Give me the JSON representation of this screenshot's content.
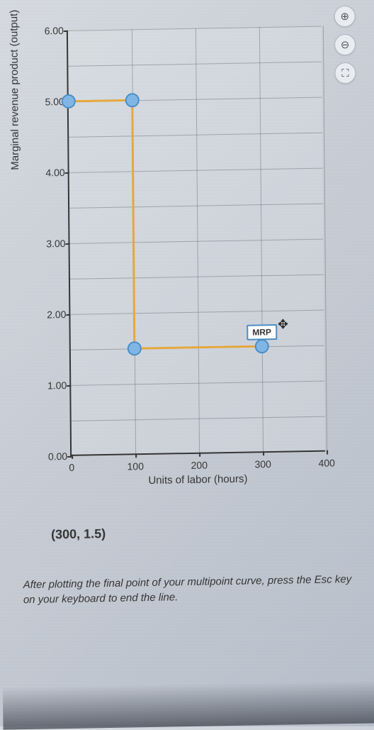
{
  "toolbar": {
    "zoom_in": "⊕",
    "zoom_out": "⊖",
    "fullscreen": "⛶"
  },
  "chart_data": {
    "type": "line",
    "title": "",
    "xlabel": "Units of labor (hours)",
    "ylabel": "Marginal revenue product (output)",
    "xlim": [
      0,
      400
    ],
    "ylim": [
      0,
      6.0
    ],
    "x_ticks": [
      0,
      100,
      200,
      300,
      400
    ],
    "y_ticks": [
      0.0,
      1.0,
      2.0,
      3.0,
      4.0,
      5.0,
      6.0
    ],
    "series": [
      {
        "name": "MRP",
        "x": [
          0,
          100,
          100,
          300
        ],
        "y": [
          5.0,
          5.0,
          1.5,
          1.5
        ]
      }
    ],
    "cursor_point": {
      "x": 300,
      "y": 1.5
    }
  },
  "readout_label": "(300, 1.5)",
  "instruction_text": "After plotting the final point of your multipoint curve, press the Esc key on your keyboard to end the line."
}
